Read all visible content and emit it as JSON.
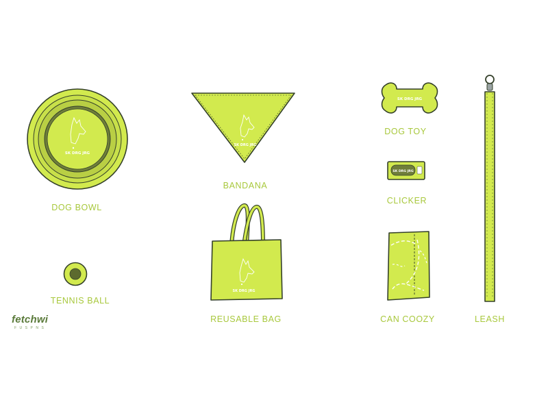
{
  "brand": {
    "wordmark": "fetchwi",
    "subtext": "FUSPNS"
  },
  "print_text": "SK DRG JRG",
  "colors": {
    "product_fill": "#d2ea4e",
    "outline": "#34402a",
    "label_text": "#a8c83c"
  },
  "products": {
    "dog_bowl": {
      "label": "DOG BOWL"
    },
    "bandana": {
      "label": "BANDANA"
    },
    "dog_toy": {
      "label": "DOG TOY"
    },
    "clicker": {
      "label": "CLICKER"
    },
    "tennis_ball": {
      "label": "TENNIS BALL"
    },
    "reusable_bag": {
      "label": "REUSABLE BAG"
    },
    "can_coozy": {
      "label": "CAN COOZY"
    },
    "leash": {
      "label": "LEASH"
    }
  }
}
